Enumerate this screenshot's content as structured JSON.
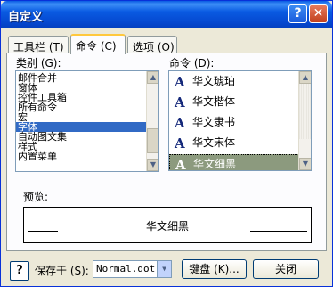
{
  "window": {
    "title": "自定义",
    "help_glyph": "?",
    "close_glyph": "✕"
  },
  "tabs": [
    {
      "label": "工具栏 (T)",
      "active": false
    },
    {
      "label": "命令 (C)",
      "active": true
    },
    {
      "label": "选项 (O)",
      "active": false
    }
  ],
  "categories": {
    "label": "类别 (G):",
    "items": [
      "邮件合并",
      "窗体",
      "控件工具箱",
      "所有命令",
      "宏",
      "字体",
      "自动图文集",
      "样式",
      "内置菜单"
    ],
    "selected_index": 5
  },
  "commands": {
    "label": "命令 (D):",
    "icon_glyph": "A",
    "items": [
      "华文琥珀",
      "华文楷体",
      "华文隶书",
      "华文宋体",
      "华文细黑"
    ],
    "selected_index": 4
  },
  "preview": {
    "label": "预览:",
    "text": "华文细黑"
  },
  "bottom": {
    "help_glyph": "?",
    "save_in_label": "保存于 (S):",
    "save_in_value": "Normal.dot",
    "keyboard_label": "键盘 (K)...",
    "close_label": "关闭"
  },
  "colors": {
    "title_bar": "#0a5be2",
    "selection": "#316ac5",
    "selected_font_item": "#8c9a7e",
    "face": "#ece9d8"
  }
}
